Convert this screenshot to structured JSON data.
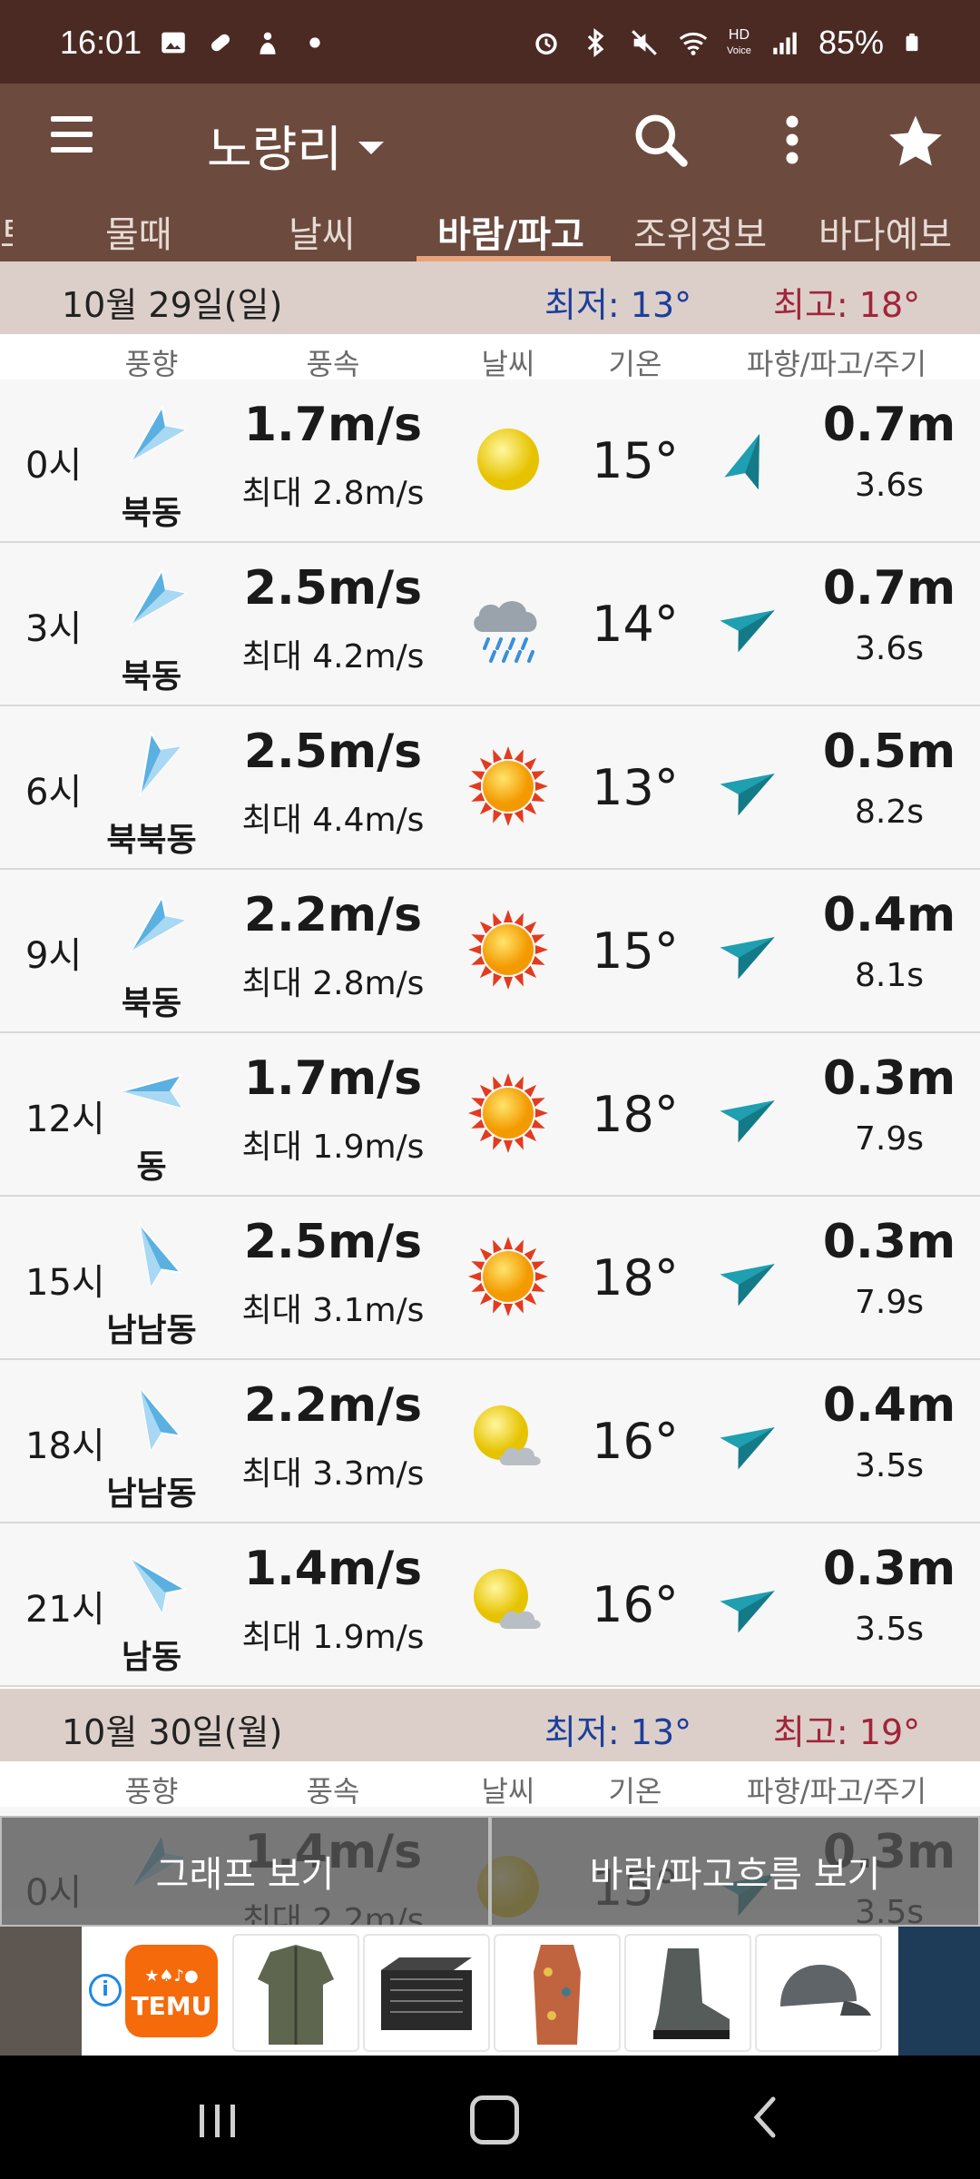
{
  "status_bar": {
    "time": "16:01",
    "battery": "85%",
    "hd_label": "HD",
    "voice_label": "Voice"
  },
  "appbar": {
    "location": "노량리",
    "icons": [
      "menu-icon",
      "search-icon",
      "more-vert-icon",
      "star-icon"
    ]
  },
  "tabs": [
    {
      "label": "물때",
      "active": false
    },
    {
      "label": "날씨",
      "active": false
    },
    {
      "label": "바람/파고",
      "active": true
    },
    {
      "label": "조위정보",
      "active": false
    },
    {
      "label": "바다예보",
      "active": false
    }
  ],
  "tab_edge_fragment": "토",
  "columns": {
    "wind_dir": "풍향",
    "wind_speed": "풍속",
    "weather": "날씨",
    "temp": "기온",
    "wave": "파향/파고/주기"
  },
  "days": [
    {
      "date": "10월 29일(일)",
      "min": "최저: 13°",
      "max": "최고: 18°",
      "rows": [
        {
          "time": "0시",
          "dir": "북동",
          "dir_deg": 45,
          "speed": "1.7m/s",
          "max": "최대 2.8m/s",
          "weather": "sun-icon",
          "temp": "15°",
          "wave_deg": 20,
          "wave": "0.7m",
          "period": "3.6s"
        },
        {
          "time": "3시",
          "dir": "북동",
          "dir_deg": 45,
          "speed": "2.5m/s",
          "max": "최대 4.2m/s",
          "weather": "rain-cloud-icon",
          "temp": "14°",
          "wave_deg": 60,
          "wave": "0.7m",
          "period": "3.6s"
        },
        {
          "time": "6시",
          "dir": "북북동",
          "dir_deg": 25,
          "speed": "2.5m/s",
          "max": "최대 4.4m/s",
          "weather": "sunny-icon",
          "temp": "13°",
          "wave_deg": 60,
          "wave": "0.5m",
          "period": "8.2s"
        },
        {
          "time": "9시",
          "dir": "북동",
          "dir_deg": 45,
          "speed": "2.2m/s",
          "max": "최대 2.8m/s",
          "weather": "sunny-icon",
          "temp": "15°",
          "wave_deg": 60,
          "wave": "0.4m",
          "period": "8.1s"
        },
        {
          "time": "12시",
          "dir": "동",
          "dir_deg": 90,
          "speed": "1.7m/s",
          "max": "최대 1.9m/s",
          "weather": "sunny-icon",
          "temp": "18°",
          "wave_deg": 60,
          "wave": "0.3m",
          "period": "7.9s"
        },
        {
          "time": "15시",
          "dir": "남남동",
          "dir_deg": 155,
          "speed": "2.5m/s",
          "max": "최대 3.1m/s",
          "weather": "sunny-icon",
          "temp": "18°",
          "wave_deg": 60,
          "wave": "0.3m",
          "period": "7.9s"
        },
        {
          "time": "18시",
          "dir": "남남동",
          "dir_deg": 155,
          "speed": "2.2m/s",
          "max": "최대 3.3m/s",
          "weather": "partly-cloudy-icon",
          "temp": "16°",
          "wave_deg": 60,
          "wave": "0.4m",
          "period": "3.5s"
        },
        {
          "time": "21시",
          "dir": "남동",
          "dir_deg": 135,
          "speed": "1.4m/s",
          "max": "최대 1.9m/s",
          "weather": "partly-cloudy-icon",
          "temp": "16°",
          "wave_deg": 60,
          "wave": "0.3m",
          "period": "3.5s"
        }
      ]
    },
    {
      "date": "10월 30일(월)",
      "min": "최저: 13°",
      "max": "최고: 19°",
      "rows": [
        {
          "time": "0시",
          "dir": "",
          "dir_deg": 45,
          "speed": "1.4m/s",
          "max": "최대 2.2m/s",
          "weather": "sun-icon",
          "temp": "15°",
          "wave_deg": 60,
          "wave": "0.3m",
          "period": "3.5s"
        }
      ]
    }
  ],
  "bottom_buttons": {
    "graph": "그래프 보기",
    "flow": "바람/파고흐름 보기"
  },
  "ad": {
    "brand": "TEMU",
    "products": [
      "jacket",
      "pet-carrier",
      "dress",
      "boot",
      "cap"
    ]
  },
  "colors": {
    "status_bar": "#4b2a24",
    "appbar": "#6c4a3e",
    "day_header": "#dccfc9",
    "min_temp": "#1d3e9b",
    "max_temp": "#a0253b",
    "tab_underline": "#e8a27a",
    "wind_arrow": "#5ab0e0",
    "wave_arrow": "#1f9fb0"
  }
}
